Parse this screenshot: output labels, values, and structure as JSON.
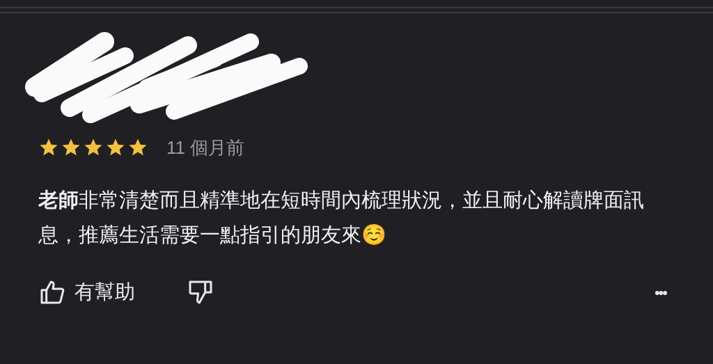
{
  "review": {
    "stars": 5,
    "time": "11 個月前",
    "text": "**老師**非常清楚而且精準地在短時間內梳理狀況，並且耐心解讀牌面訊息，推薦生活需要一點指引的朋友來☺️"
  },
  "actions": {
    "helpful": "有幫助",
    "more": "•••"
  }
}
